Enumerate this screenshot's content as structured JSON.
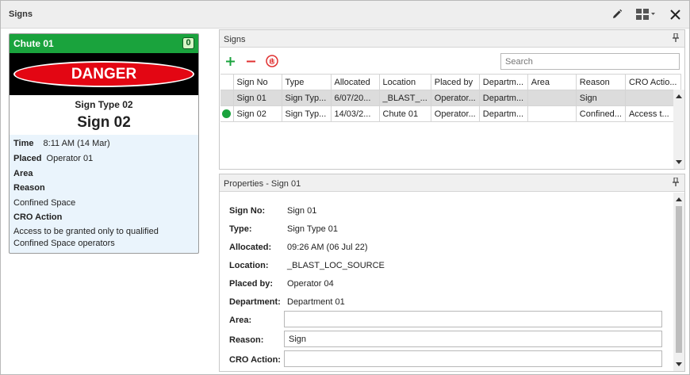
{
  "window": {
    "title": "Signs"
  },
  "card": {
    "location": "Chute 01",
    "count": "0",
    "banner": "DANGER",
    "sign_type": "Sign Type 02",
    "sign_name": "Sign 02",
    "time_label": "Time",
    "time_value": "8:11 AM (14 Mar)",
    "placed_label": "Placed",
    "placed_value": "Operator 01",
    "area_label": "Area",
    "reason_label": "Reason",
    "reason_value": "Confined Space",
    "cro_label": "CRO Action",
    "cro_value_line1": "Access to be granted only to qualified",
    "cro_value_line2": "Confined Space operators",
    "header_color": "#1aa33d",
    "banner_color": "#e30613"
  },
  "signs_panel": {
    "title": "Signs",
    "search_placeholder": "Search",
    "columns": [
      "",
      "Sign No",
      "Type",
      "Allocated",
      "Location",
      "Placed by",
      "Departm...",
      "Area",
      "Reason",
      "CRO Actio..."
    ],
    "rows": [
      {
        "status": "",
        "sign_no": "Sign 01",
        "type": "Sign Typ...",
        "allocated": "6/07/20...",
        "location": "_BLAST_...",
        "placed_by": "Operator...",
        "department": "Departm...",
        "area": "",
        "reason": "Sign",
        "cro_action": "",
        "selected": true
      },
      {
        "status": "active",
        "sign_no": "Sign 02",
        "type": "Sign Typ...",
        "allocated": "14/03/2...",
        "location": "Chute 01",
        "placed_by": "Operator...",
        "department": "Departm...",
        "area": "",
        "reason": "Confined...",
        "cro_action": "Access t...",
        "selected": false
      }
    ]
  },
  "properties_panel": {
    "title": "Properties - Sign 01",
    "sign_no_label": "Sign No:",
    "sign_no_value": "Sign 01",
    "type_label": "Type:",
    "type_value": "Sign Type 01",
    "allocated_label": "Allocated:",
    "allocated_value": "09:26 AM (06 Jul 22)",
    "location_label": "Location:",
    "location_value": "_BLAST_LOC_SOURCE",
    "placed_by_label": "Placed by:",
    "placed_by_value": "Operator 04",
    "department_label": "Department:",
    "department_value": "Department 01",
    "area_label": "Area:",
    "area_value": "",
    "reason_label": "Reason:",
    "reason_value": "Sign",
    "cro_label": "CRO Action:",
    "cro_value": ""
  },
  "icons": {
    "edit": "pencil-icon",
    "layout": "grid-layout-icon",
    "close": "close-icon",
    "pin": "pin-icon",
    "add": "plus-icon",
    "remove": "minus-icon",
    "stop": "stop-hand-icon"
  }
}
